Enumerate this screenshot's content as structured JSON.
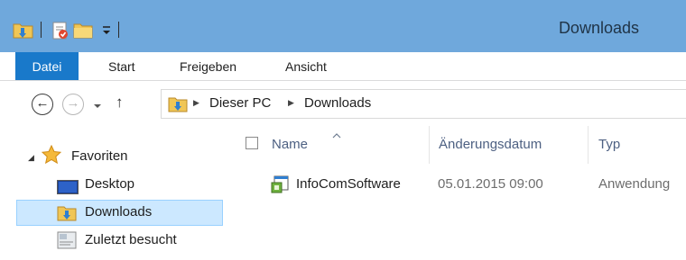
{
  "window": {
    "title": "Downloads"
  },
  "quick_access": {
    "icons": [
      "folder-down-arrow-icon",
      "properties-icon",
      "new-folder-icon",
      "customize-chevron-icon"
    ]
  },
  "ribbon": {
    "tabs": [
      {
        "label": "Datei",
        "active": true
      },
      {
        "label": "Start"
      },
      {
        "label": "Freigeben"
      },
      {
        "label": "Ansicht"
      }
    ]
  },
  "address": {
    "crumbs": [
      "Dieser PC",
      "Downloads"
    ],
    "icons": [
      "back-arrow-icon",
      "forward-arrow-icon",
      "recent-locations-chevron-icon",
      "up-arrow-icon"
    ]
  },
  "nav_pane": {
    "favorites_label": "Favoriten",
    "items": [
      {
        "label": "Desktop",
        "icon": "desktop-icon"
      },
      {
        "label": "Downloads",
        "icon": "downloads-folder-icon",
        "selected": true
      },
      {
        "label": "Zuletzt besucht",
        "icon": "recent-places-icon"
      }
    ]
  },
  "file_list": {
    "columns": [
      "Name",
      "Änderungsdatum",
      "Typ"
    ],
    "sorted_by": "Name",
    "rows": [
      {
        "name": "InfoComSoftware",
        "date": "05.01.2015 09:00",
        "type": "Anwendung"
      }
    ]
  },
  "colors": {
    "titlebar": "#6fa8dc",
    "file_tab": "#1979ca",
    "selection": "#cce8ff",
    "selection_border": "#99d1ff",
    "header_text": "#4d6082"
  }
}
